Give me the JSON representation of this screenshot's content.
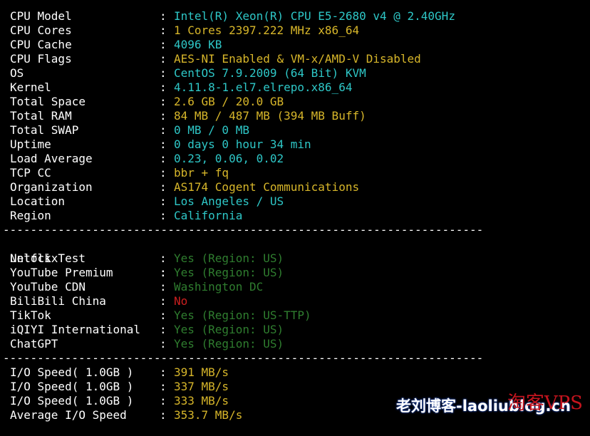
{
  "system": [
    {
      "label": "CPU Model",
      "value": "Intel(R) Xeon(R) CPU E5-2680 v4 @ 2.40GHz",
      "color": "cyan"
    },
    {
      "label": "CPU Cores",
      "value": "1 Cores 2397.222 MHz x86_64",
      "color": "yellow"
    },
    {
      "label": "CPU Cache",
      "value": "4096 KB",
      "color": "cyan"
    },
    {
      "label": "CPU Flags",
      "value": "AES-NI Enabled & VM-x/AMD-V Disabled",
      "color": "yellow"
    },
    {
      "label": "OS",
      "value": "CentOS 7.9.2009 (64 Bit) KVM",
      "color": "cyan"
    },
    {
      "label": "Kernel",
      "value": "4.11.8-1.el7.elrepo.x86_64",
      "color": "cyan"
    },
    {
      "label": "Total Space",
      "value": "2.6 GB / 20.0 GB",
      "color": "yellow"
    },
    {
      "label": "Total RAM",
      "value": "84 MB / 487 MB (394 MB Buff)",
      "color": "yellow"
    },
    {
      "label": "Total SWAP",
      "value": "0 MB / 0 MB",
      "color": "cyan"
    },
    {
      "label": "Uptime",
      "value": "0 days 0 hour 34 min",
      "color": "cyan"
    },
    {
      "label": "Load Average",
      "value": "0.23, 0.06, 0.02",
      "color": "cyan"
    },
    {
      "label": "TCP CC",
      "value": "bbr + fq",
      "color": "yellow"
    },
    {
      "label": "Organization",
      "value": "AS174 Cogent Communications",
      "color": "yellow"
    },
    {
      "label": "Location",
      "value": "Los Angeles / US",
      "color": "cyan"
    },
    {
      "label": "Region",
      "value": "California",
      "color": "cyan"
    }
  ],
  "separator": "----------------------------------------------------------------------",
  "unlock_header": {
    "label": "Unlock Test",
    "value": ""
  },
  "unlock": [
    {
      "label": "Netflix",
      "value": "Yes (Region: US)",
      "color": "green"
    },
    {
      "label": "YouTube Premium",
      "value": "Yes (Region: US)",
      "color": "green"
    },
    {
      "label": "YouTube CDN",
      "value": "Washington DC",
      "color": "green"
    },
    {
      "label": "BiliBili China",
      "value": "No",
      "color": "red"
    },
    {
      "label": "TikTok",
      "value": "Yes (Region: US-TTP)",
      "color": "green"
    },
    {
      "label": "iQIYI International",
      "value": "Yes (Region: US)",
      "color": "green"
    },
    {
      "label": "ChatGPT",
      "value": "Yes (Region: US)",
      "color": "green"
    }
  ],
  "io": [
    {
      "label": "I/O Speed( 1.0GB )",
      "value": "391 MB/s",
      "color": "yellow"
    },
    {
      "label": "I/O Speed( 1.0GB )",
      "value": "337 MB/s",
      "color": "yellow"
    },
    {
      "label": "I/O Speed( 1.0GB )",
      "value": "333 MB/s",
      "color": "yellow"
    },
    {
      "label": "Average I/O Speed",
      "value": "353.7 MB/s",
      "color": "yellow"
    }
  ],
  "colon": ":",
  "colors": {
    "background": "#000000",
    "label": "#ffffff",
    "cyan": "#2ec7c7",
    "yellow": "#d7b62a",
    "green": "#2f7d2f",
    "red": "#cc1f1f"
  },
  "watermark": {
    "text": "老刘博客-laoliublog.cn",
    "brand": "淘客VPS"
  }
}
